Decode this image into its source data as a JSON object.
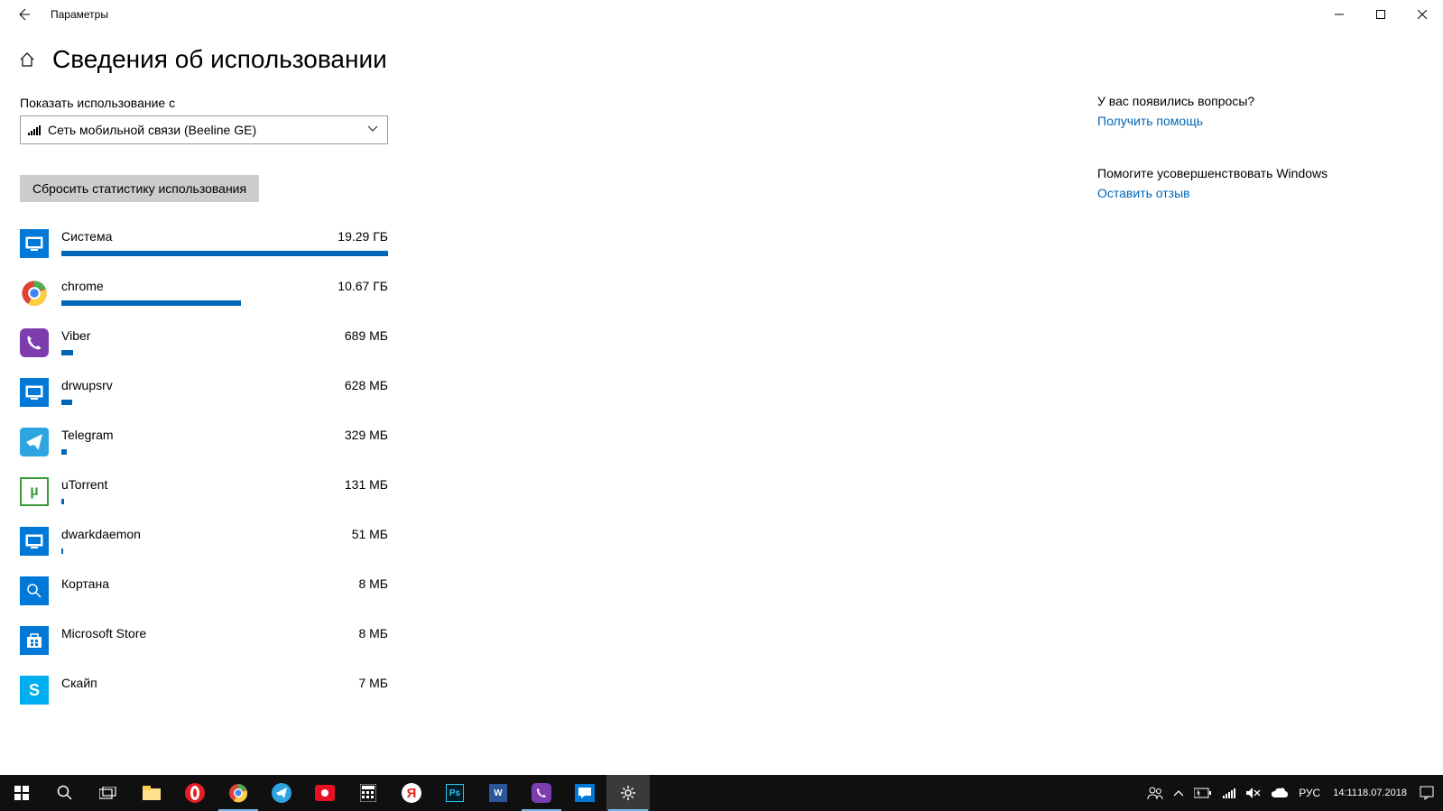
{
  "window": {
    "title": "Параметры"
  },
  "page": {
    "heading": "Сведения об использовании",
    "show_usage_from_label": "Показать использование с",
    "dropdown_selected": "Сеть мобильной связи (Beeline GE)",
    "reset_button": "Сбросить статистику использования"
  },
  "apps": [
    {
      "name": "Система",
      "usage": "19.29 ГБ",
      "bar_pct": 100,
      "icon": "system"
    },
    {
      "name": "chrome",
      "usage": "10.67 ГБ",
      "bar_pct": 55,
      "icon": "chrome"
    },
    {
      "name": "Viber",
      "usage": "689 МБ",
      "bar_pct": 3.5,
      "icon": "viber"
    },
    {
      "name": "drwupsrv",
      "usage": "628 МБ",
      "bar_pct": 3.2,
      "icon": "system"
    },
    {
      "name": "Telegram",
      "usage": "329 МБ",
      "bar_pct": 1.7,
      "icon": "telegram"
    },
    {
      "name": "uTorrent",
      "usage": "131 МБ",
      "bar_pct": 0.7,
      "icon": "utorrent"
    },
    {
      "name": "dwarkdaemon",
      "usage": "51 МБ",
      "bar_pct": 0.3,
      "icon": "system"
    },
    {
      "name": "Кортана",
      "usage": "8 МБ",
      "bar_pct": 0,
      "icon": "cortana"
    },
    {
      "name": "Microsoft Store",
      "usage": "8 МБ",
      "bar_pct": 0,
      "icon": "store"
    },
    {
      "name": "Скайп",
      "usage": "7 МБ",
      "bar_pct": 0,
      "icon": "skype"
    }
  ],
  "sidebar": {
    "question": "У вас появились вопросы?",
    "get_help": "Получить помощь",
    "improve": "Помогите усовершенствовать Windows",
    "feedback": "Оставить отзыв"
  },
  "taskbar": {
    "lang": "РУС",
    "time": "14:11",
    "date": "18.07.2018"
  }
}
